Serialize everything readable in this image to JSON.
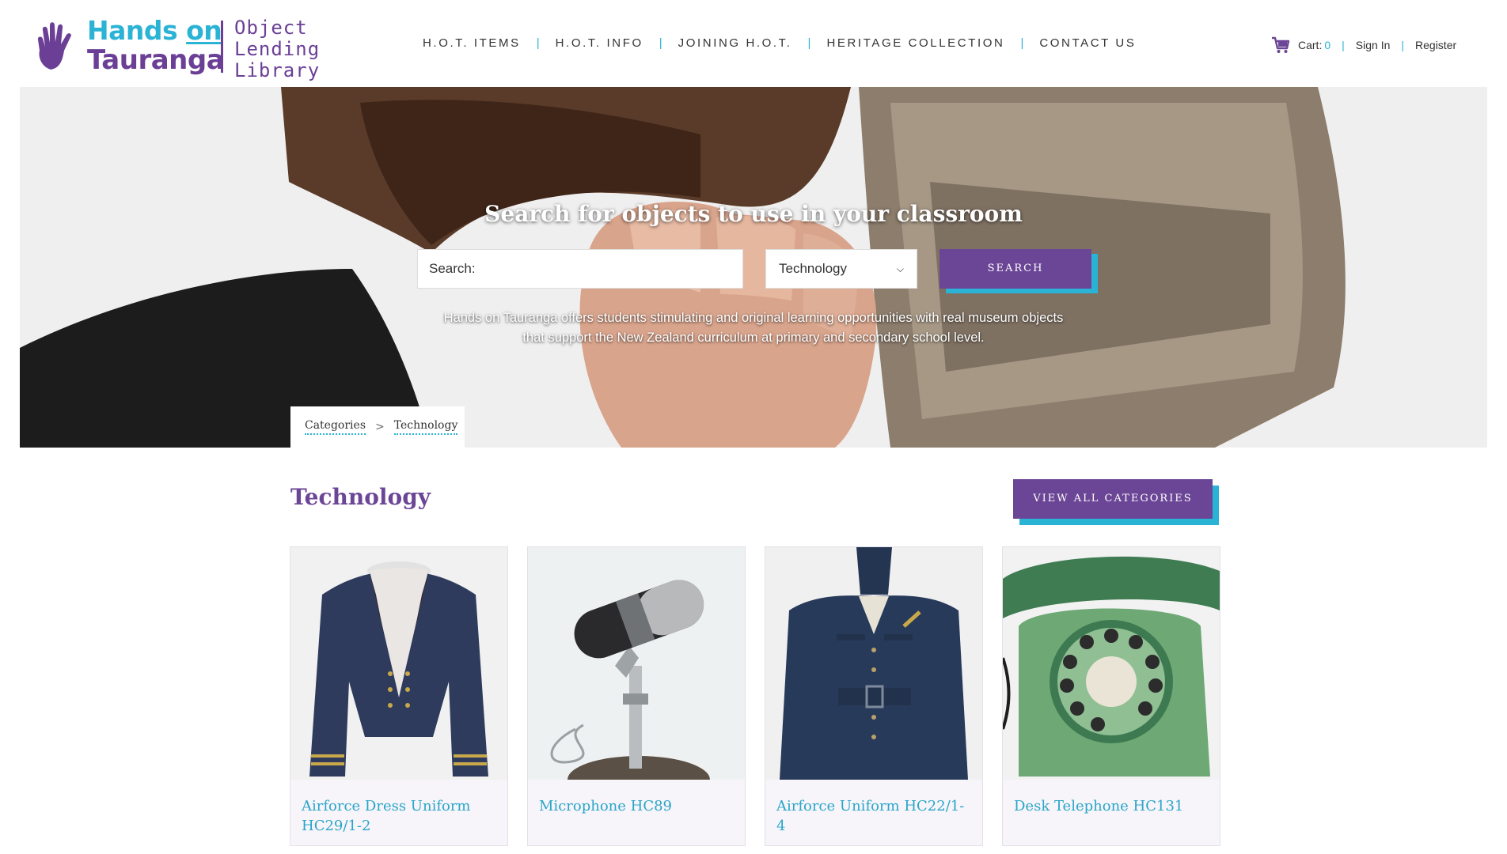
{
  "header": {
    "logo": {
      "line1": "Hands on",
      "line1_a": "Hands ",
      "line1_b": "on",
      "line2": "Tauranga",
      "sub1": "Object",
      "sub2": "Lending",
      "sub3": "Library"
    },
    "nav": [
      "H.O.T. ITEMS",
      "H.O.T. INFO",
      "JOINING H.O.T.",
      "HERITAGE COLLECTION",
      "CONTACT US"
    ],
    "nav_separator": "|",
    "account": {
      "cart_label": "Cart:",
      "cart_count": "0",
      "sign_in": "Sign In",
      "register": "Register"
    }
  },
  "hero": {
    "title": "Search for objects to use in your classroom",
    "search_value": "Search:",
    "category_selected": "Technology",
    "search_button": "SEARCH",
    "description_line1": "Hands on Tauranga offers students stimulating and original learning opportunities with real museum objects",
    "description_line2": "that support the New Zealand curriculum at primary and secondary school level."
  },
  "breadcrumb": {
    "root": "Categories",
    "sep": ">",
    "current": "Technology"
  },
  "category": {
    "title": "Technology",
    "view_all": "VIEW ALL CATEGORIES",
    "items": [
      {
        "name": "Airforce Dress Uniform HC29/1-2",
        "icon": "jacket-photo"
      },
      {
        "name": "Microphone HC89",
        "icon": "microphone-photo"
      },
      {
        "name": "Airforce Uniform HC22/1-4",
        "icon": "uniform-photo"
      },
      {
        "name": "Desk Telephone HC131",
        "icon": "telephone-photo"
      }
    ]
  },
  "colors": {
    "brand_purple": "#6b4596",
    "brand_blue": "#2bb3d6"
  }
}
